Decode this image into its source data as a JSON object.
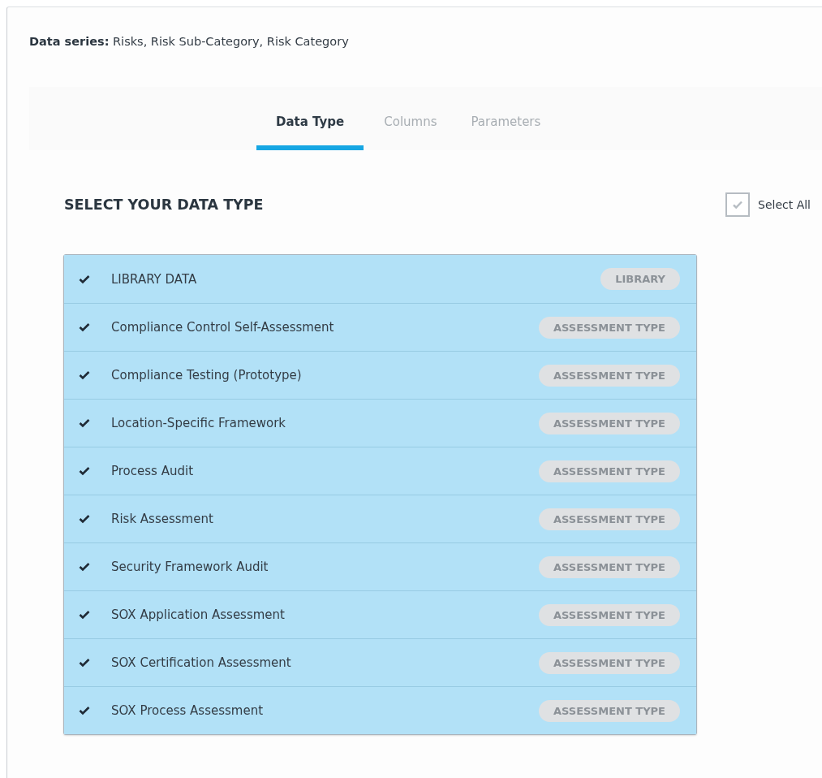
{
  "header": {
    "text": "**Data series:** Risks, Risk Sub-Category, Risk Category"
  },
  "tabs": [
    {
      "label": "Data Type",
      "selected": true
    },
    {
      "label": "Columns",
      "selected": false
    },
    {
      "label": "Parameters",
      "selected": false
    }
  ],
  "section_title": "SELECT YOUR DATA TYPE",
  "select_all": {
    "label": "Select All",
    "checked": true
  },
  "items": [
    {
      "label": "LIBRARY DATA",
      "badge": "LIBRARY",
      "selected": true
    },
    {
      "label": "Compliance Control Self-Assessment",
      "badge": "ASSESSMENT TYPE",
      "selected": true
    },
    {
      "label": "Compliance Testing (Prototype)",
      "badge": "ASSESSMENT TYPE",
      "selected": true
    },
    {
      "label": "Location-Specific Framework",
      "badge": "ASSESSMENT TYPE",
      "selected": true
    },
    {
      "label": "Process Audit",
      "badge": "ASSESSMENT TYPE",
      "selected": true
    },
    {
      "label": "Risk Assessment",
      "badge": "ASSESSMENT TYPE",
      "selected": true
    },
    {
      "label": "Security Framework Audit",
      "badge": "ASSESSMENT TYPE",
      "selected": true
    },
    {
      "label": "SOX Application Assessment",
      "badge": "ASSESSMENT TYPE",
      "selected": true
    },
    {
      "label": "SOX Certification Assessment",
      "badge": "ASSESSMENT TYPE",
      "selected": true
    },
    {
      "label": "SOX Process Assessment",
      "badge": "ASSESSMENT TYPE",
      "selected": true
    }
  ]
}
